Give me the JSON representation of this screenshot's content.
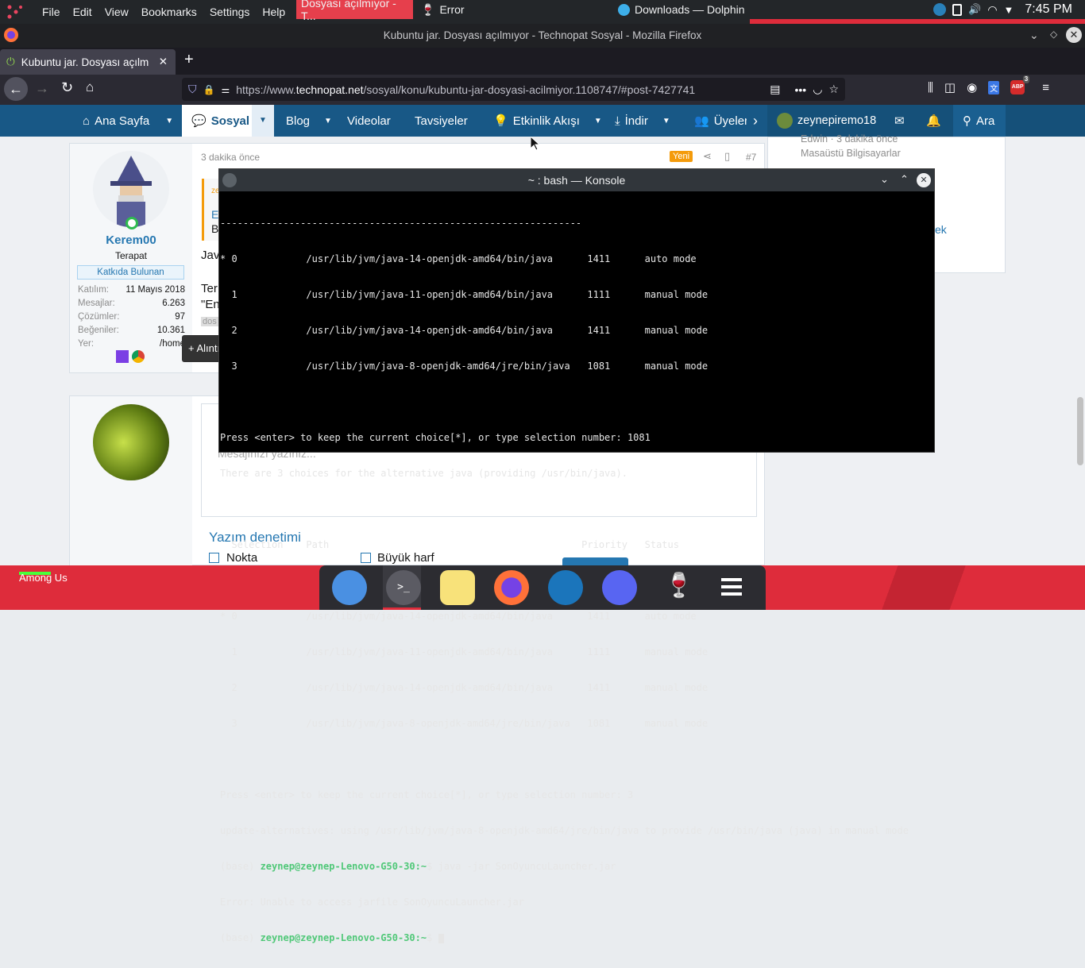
{
  "top_panel": {
    "menu": [
      "File",
      "Edit",
      "View",
      "Bookmarks",
      "Settings",
      "Help"
    ],
    "tasks": [
      "Dosyası açılmıyor - T...",
      "Error",
      "Downloads — Dolphin"
    ],
    "clock": "7:45 PM"
  },
  "firefox": {
    "window_title": "Kubuntu jar. Dosyası açılmıyor - Technopat Sosyal - Mozilla Firefox",
    "tab_title": "Kubuntu jar. Dosyası açılm",
    "url_prefix": "https://www.",
    "url_domain": "technopat.net",
    "url_rest": "/sosyal/konu/kubuntu-jar-dosyasi-acilmiyor.1108747/#post-7427741",
    "abp_count": "3"
  },
  "site_nav": {
    "items": [
      "Ana Sayfa",
      "Sosyal",
      "Blog",
      "Videolar",
      "Tavsiyeler",
      "Etkinlik Akışı",
      "İndir",
      "Üyeler"
    ],
    "user": "zeynepiremo18",
    "search": "Ara"
  },
  "post": {
    "time": "3 dakika önce",
    "badge_new": "Yeni",
    "post_no": "#7",
    "author": "Kerem00",
    "role": "Terapat",
    "contributor": "Katkıda Bulunan",
    "stats": [
      {
        "k": "Katılım:",
        "v": "11 Mayıs 2018"
      },
      {
        "k": "Mesajlar:",
        "v": "6.263"
      },
      {
        "k": "Çözümler:",
        "v": "97"
      },
      {
        "k": "Beğeniler:",
        "v": "10.361"
      },
      {
        "k": "Yer:",
        "v": "/home"
      }
    ],
    "quote_btn": "+ Alıntı",
    "snippets": [
      "Jav",
      "Ter",
      "\"En",
      "dos",
      "E",
      "B",
      "ze"
    ]
  },
  "reply": {
    "placeholder": "Mesajınızı yazınız...",
    "spell_title": "Yazım denetimi",
    "opt1": "Nokta",
    "opt2": "Büyük harf"
  },
  "sidebar": {
    "line1": "Edwin · 3 dakika önce",
    "line2": "Masaüstü Bilgisayarlar",
    "partial": "ek"
  },
  "konsole": {
    "title": "~ : bash — Konsole",
    "prompt_user": "zeynep@zeynep-Lenovo-G50-30",
    "lines": [
      "---------------------------------------------------------------",
      "* 0            /usr/lib/jvm/java-14-openjdk-amd64/bin/java      1411      auto mode",
      "  1            /usr/lib/jvm/java-11-openjdk-amd64/bin/java      1111      manual mode",
      "  2            /usr/lib/jvm/java-14-openjdk-amd64/bin/java      1411      manual mode",
      "  3            /usr/lib/jvm/java-8-openjdk-amd64/jre/bin/java   1081      manual mode",
      "",
      "Press <enter> to keep the current choice[*], or type selection number: 1081",
      "There are 3 choices for the alternative java (providing /usr/bin/java).",
      "",
      "  Selection    Path                                            Priority   Status",
      "------------------------------------------------------------",
      "* 0            /usr/lib/jvm/java-14-openjdk-amd64/bin/java      1411      auto mode",
      "  1            /usr/lib/jvm/java-11-openjdk-amd64/bin/java      1111      manual mode",
      "  2            /usr/lib/jvm/java-14-openjdk-amd64/bin/java      1411      manual mode",
      "  3            /usr/lib/jvm/java-8-openjdk-amd64/jre/bin/java   1081      manual mode",
      "",
      "Press <enter> to keep the current choice[*], or type selection number: 3",
      "update-alternatives: using /usr/lib/jvm/java-8-openjdk-amd64/jre/bin/java to provide /usr/bin/java (java) in manual mode"
    ],
    "cmd1": "$ java -jar SonOyuncuLauncher.jar",
    "error": "Error: Unable to access jarfile SonOyuncuLauncher.jar",
    "cmd2": "$ ",
    "prefix": "(base) "
  },
  "taskbar": {
    "among_us": "Among Us"
  },
  "colors": {
    "site_blue": "#185886",
    "taskbar_red": "#de2c3b",
    "terminal_bg": "#000000"
  }
}
